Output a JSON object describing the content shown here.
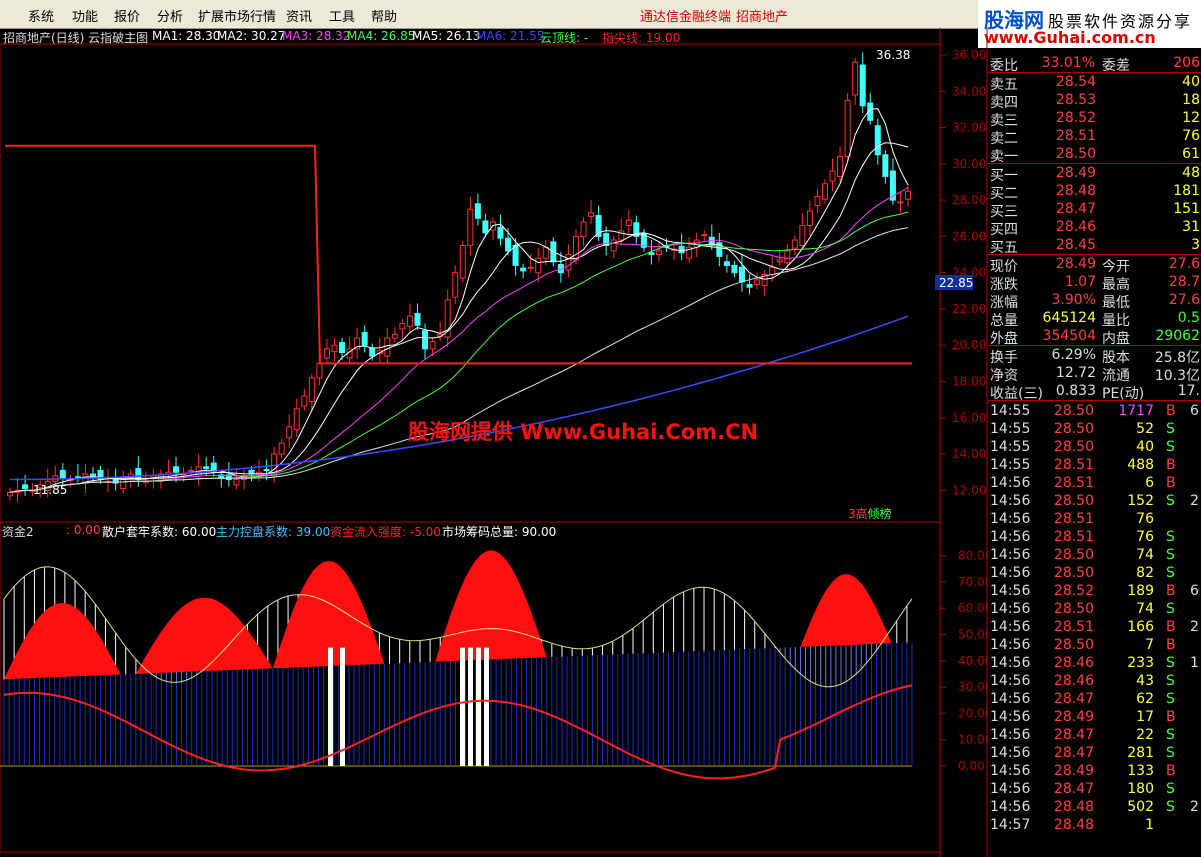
{
  "menu": [
    "系统",
    "功能",
    "报价",
    "分析",
    "扩展市场行情",
    "资讯",
    "工具",
    "帮助"
  ],
  "top_info": {
    "left": "通达信金融终端",
    "right": "招商地产"
  },
  "logo": {
    "brand": "股海网",
    "tagline": "股票软件资源分享",
    "url": "www.Guhai.com.cn"
  },
  "title": {
    "name": "招商地产(日线) 云指破主图",
    "ma": [
      {
        "label": "MA1: 28.30",
        "color": "#ffffff"
      },
      {
        "label": "MA2: 30.27",
        "color": "#ffffff"
      },
      {
        "label": "MA3: 28.32",
        "color": "#ff40ff"
      },
      {
        "label": "MA4: 26.85",
        "color": "#40ff40"
      },
      {
        "label": "MA5: 26.13",
        "color": "#ffffff"
      },
      {
        "label": "MA6: 21.55",
        "color": "#4040ff"
      },
      {
        "label": "云顶线: -",
        "color": "#40ff40"
      },
      {
        "label": "指尖线: 19.00",
        "color": "#ff2020"
      }
    ]
  },
  "watermark": "股海网提供 Www.Guhai.Com.CN",
  "badge": {
    "a": "3高",
    "b": "倾榜"
  },
  "ind_title": [
    {
      "label": "资金2",
      "color": "#dddddd"
    },
    {
      "label": ": 0.00",
      "color": "#ff4040"
    },
    {
      "label": "散户套牢系数: 60.00",
      "color": "#ffffff"
    },
    {
      "label": "主力控盘系数: 39.00",
      "color": "#40c0ff"
    },
    {
      "label": "资金流入强度: -5.00",
      "color": "#ff2020"
    },
    {
      "label": "市场筹码总量: 90.00",
      "color": "#ffffff"
    }
  ],
  "chart_data": [
    {
      "type": "candlestick",
      "title": "招商地产(日线) 云指破主图",
      "y_ticks": [
        "36.00",
        "34.00",
        "32.00",
        "30.00",
        "28.00",
        "26.00",
        "24.00",
        "22.00",
        "20.00",
        "18.00",
        "16.00",
        "14.00",
        "12.00"
      ],
      "ylim": [
        11,
        37
      ],
      "annotations": {
        "high": "36.38",
        "low": "11.85",
        "current_line": "22.85"
      },
      "close": [
        11.9,
        12.0,
        12.1,
        12.0,
        12.3,
        12.5,
        12.8,
        12.7,
        12.6,
        12.7,
        12.9,
        12.8,
        12.6,
        12.5,
        12.4,
        12.7,
        12.9,
        12.6,
        12.5,
        12.8,
        12.9,
        13.0,
        13.0,
        12.9,
        13.1,
        13.3,
        13.2,
        13.0,
        12.7,
        12.6,
        12.6,
        12.8,
        12.9,
        13.0,
        13.1,
        14.0,
        14.6,
        15.5,
        16.5,
        17.2,
        18.2,
        19.0,
        19.8,
        20.0,
        19.6,
        19.8,
        20.4,
        20.0,
        19.4,
        19.7,
        20.4,
        20.6,
        21.2,
        21.6,
        21.1,
        19.8,
        20.2,
        20.6,
        22.5,
        24.0,
        25.5,
        27.5,
        27.0,
        26.2,
        26.8,
        25.9,
        25.2,
        24.4,
        24.1,
        24.3,
        24.8,
        25.4,
        24.6,
        24.0,
        25.0,
        26.0,
        26.8,
        27.3,
        26.0,
        25.5,
        25.8,
        26.3,
        26.9,
        26.0,
        25.4,
        25.0,
        25.2,
        25.4,
        25.3,
        25.1,
        25.4,
        25.8,
        26.1,
        25.5,
        24.9,
        24.4,
        24.0,
        23.5,
        23.2,
        23.6,
        23.9,
        24.3,
        24.7,
        25.2,
        25.8,
        26.6,
        27.4,
        28.2,
        28.9,
        29.6,
        30.4,
        33.5,
        35.6,
        33.2,
        32.4,
        30.5,
        29.3,
        28.0,
        27.9,
        28.49
      ],
      "ma_values": {
        "MA1": 28.3,
        "MA2": 30.27,
        "MA3": 28.32,
        "MA4": 26.85,
        "MA5": 26.13,
        "MA6": 21.55,
        "指尖线": 19.0
      }
    },
    {
      "type": "area",
      "title": "资金2",
      "y_ticks": [
        "80.00",
        "70.00",
        "60.00",
        "50.00",
        "40.00",
        "30.00",
        "20.00",
        "10.00",
        "0.00"
      ],
      "ylim": [
        -10,
        90
      ],
      "series": [
        {
          "name": "散户套牢系数",
          "values": [
            60
          ]
        },
        {
          "name": "主力控盘系数",
          "values": [
            39
          ]
        },
        {
          "name": "资金流入强度",
          "values": [
            -5
          ]
        },
        {
          "name": "市场筹码总量",
          "values": [
            90
          ]
        }
      ]
    }
  ],
  "quote": {
    "order_ratio": {
      "l1": "委比",
      "v1": "33.01%",
      "l2": "委差",
      "v2": "206"
    },
    "asks": [
      {
        "l": "卖五",
        "p": "28.54",
        "v": "40"
      },
      {
        "l": "卖四",
        "p": "28.53",
        "v": "18"
      },
      {
        "l": "卖三",
        "p": "28.52",
        "v": "12"
      },
      {
        "l": "卖二",
        "p": "28.51",
        "v": "76"
      },
      {
        "l": "卖一",
        "p": "28.50",
        "v": "61"
      }
    ],
    "bids": [
      {
        "l": "买一",
        "p": "28.49",
        "v": "48"
      },
      {
        "l": "买二",
        "p": "28.48",
        "v": "181"
      },
      {
        "l": "买三",
        "p": "28.47",
        "v": "151"
      },
      {
        "l": "买四",
        "p": "28.46",
        "v": "31"
      },
      {
        "l": "买五",
        "p": "28.45",
        "v": "3"
      }
    ],
    "stats": [
      {
        "l1": "现价",
        "v1": "28.49",
        "c1": "#ff4040",
        "l2": "今开",
        "v2": "27.6",
        "c2": "#ff4040"
      },
      {
        "l1": "涨跌",
        "v1": "1.07",
        "c1": "#ff4040",
        "l2": "最高",
        "v2": "28.7",
        "c2": "#ff4040"
      },
      {
        "l1": "涨幅",
        "v1": "3.90%",
        "c1": "#ff4040",
        "l2": "最低",
        "v2": "27.6",
        "c2": "#ff4040"
      },
      {
        "l1": "总量",
        "v1": "645124",
        "c1": "#ffff40",
        "l2": "量比",
        "v2": "0.5",
        "c2": "#40ff40"
      },
      {
        "l1": "外盘",
        "v1": "354504",
        "c1": "#ff4040",
        "l2": "内盘",
        "v2": "29062",
        "c2": "#40ff40"
      }
    ],
    "fund": [
      {
        "l1": "换手",
        "v1": "6.29%",
        "l2": "股本",
        "v2": "25.8亿"
      },
      {
        "l1": "净资",
        "v1": "12.72",
        "l2": "流通",
        "v2": "10.3亿"
      },
      {
        "l1": "收益(三)",
        "v1": "0.833",
        "l2": "PE(动)",
        "v2": "17."
      }
    ],
    "ticks": [
      {
        "t": "14:55",
        "p": "28.50",
        "v": "1717",
        "s": "B",
        "n": "6"
      },
      {
        "t": "14:55",
        "p": "28.50",
        "v": "52",
        "s": "S",
        "n": ""
      },
      {
        "t": "14:55",
        "p": "28.50",
        "v": "40",
        "s": "S",
        "n": ""
      },
      {
        "t": "14:55",
        "p": "28.51",
        "v": "488",
        "s": "B",
        "n": ""
      },
      {
        "t": "14:56",
        "p": "28.51",
        "v": "6",
        "s": "B",
        "n": ""
      },
      {
        "t": "14:56",
        "p": "28.50",
        "v": "152",
        "s": "S",
        "n": "2"
      },
      {
        "t": "14:56",
        "p": "28.51",
        "v": "76",
        "s": "",
        "n": ""
      },
      {
        "t": "14:56",
        "p": "28.51",
        "v": "76",
        "s": "S",
        "n": ""
      },
      {
        "t": "14:56",
        "p": "28.50",
        "v": "74",
        "s": "S",
        "n": ""
      },
      {
        "t": "14:56",
        "p": "28.50",
        "v": "82",
        "s": "S",
        "n": ""
      },
      {
        "t": "14:56",
        "p": "28.52",
        "v": "189",
        "s": "B",
        "n": "6"
      },
      {
        "t": "14:56",
        "p": "28.50",
        "v": "74",
        "s": "S",
        "n": ""
      },
      {
        "t": "14:56",
        "p": "28.51",
        "v": "166",
        "s": "B",
        "n": "2"
      },
      {
        "t": "14:56",
        "p": "28.50",
        "v": "7",
        "s": "B",
        "n": ""
      },
      {
        "t": "14:56",
        "p": "28.46",
        "v": "233",
        "s": "S",
        "n": "1"
      },
      {
        "t": "14:56",
        "p": "28.46",
        "v": "43",
        "s": "S",
        "n": ""
      },
      {
        "t": "14:56",
        "p": "28.47",
        "v": "62",
        "s": "S",
        "n": ""
      },
      {
        "t": "14:56",
        "p": "28.49",
        "v": "17",
        "s": "B",
        "n": ""
      },
      {
        "t": "14:56",
        "p": "28.47",
        "v": "22",
        "s": "S",
        "n": ""
      },
      {
        "t": "14:56",
        "p": "28.47",
        "v": "281",
        "s": "S",
        "n": ""
      },
      {
        "t": "14:56",
        "p": "28.49",
        "v": "133",
        "s": "B",
        "n": ""
      },
      {
        "t": "14:56",
        "p": "28.47",
        "v": "180",
        "s": "S",
        "n": ""
      },
      {
        "t": "14:56",
        "p": "28.48",
        "v": "502",
        "s": "S",
        "n": "2"
      },
      {
        "t": "14:57",
        "p": "28.48",
        "v": "1",
        "s": "",
        "n": ""
      }
    ]
  }
}
